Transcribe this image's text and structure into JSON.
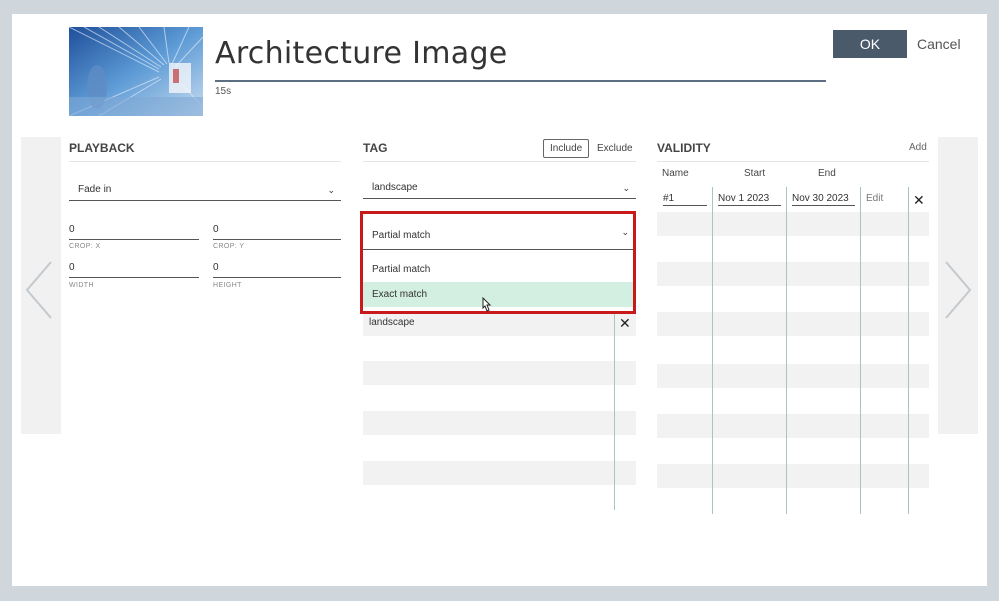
{
  "header": {
    "title": "Architecture Image",
    "duration": "15s",
    "ok_label": "OK",
    "cancel_label": "Cancel"
  },
  "playback": {
    "title": "PLAYBACK",
    "transition": "Fade in",
    "crop_x": {
      "value": "0",
      "label": "CROP: X"
    },
    "crop_y": {
      "value": "0",
      "label": "CROP: Y"
    },
    "width": {
      "value": "0",
      "label": "WIDTH"
    },
    "height": {
      "value": "0",
      "label": "HEIGHT"
    }
  },
  "tag": {
    "title": "TAG",
    "include_label": "Include",
    "exclude_label": "Exclude",
    "tag_select": "landscape",
    "match_select": "Partial match",
    "match_options": [
      "Partial match",
      "Exact match"
    ],
    "rows": [
      {
        "label": "landscape"
      }
    ]
  },
  "validity": {
    "title": "VALIDITY",
    "add_label": "Add",
    "columns": [
      "Name",
      "Start",
      "End"
    ],
    "rows": [
      {
        "name": "#1",
        "start": "Nov 1 2023",
        "end": "Nov 30 2023",
        "edit": "Edit"
      }
    ]
  },
  "colors": {
    "accent_dark": "#4a5a6a",
    "highlight_option": "#d3efe2",
    "annotation_red": "#c81a1a"
  }
}
